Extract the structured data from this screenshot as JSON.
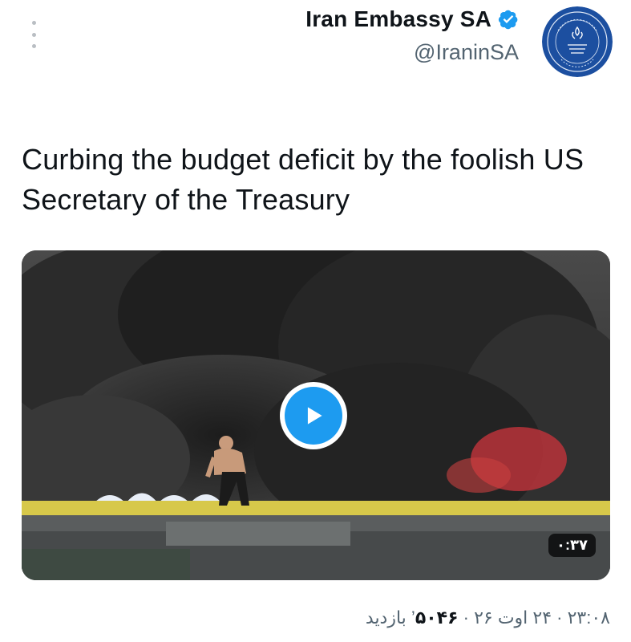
{
  "author": {
    "display_name": "Iran Embassy SA",
    "handle": "@IraninSA",
    "verified_color": "#1d9bf0",
    "avatar_color": "#1c4fa0"
  },
  "tweet": {
    "text": "Curbing the budget deficit by the foolish US Secretary of the Treasury"
  },
  "media": {
    "type": "video",
    "duration": "۰:۳۷",
    "play_color": "#1d9bf0"
  },
  "meta": {
    "time": "۲۳:۰۸",
    "date": "۲۴ اوت ۲۶",
    "separator": " · ",
    "views_count": "۵۰۴۶",
    "views_label": "بازدید"
  },
  "icons": {
    "more": "more-vertical-icon",
    "verified": "verified-badge-icon",
    "play": "play-icon"
  }
}
